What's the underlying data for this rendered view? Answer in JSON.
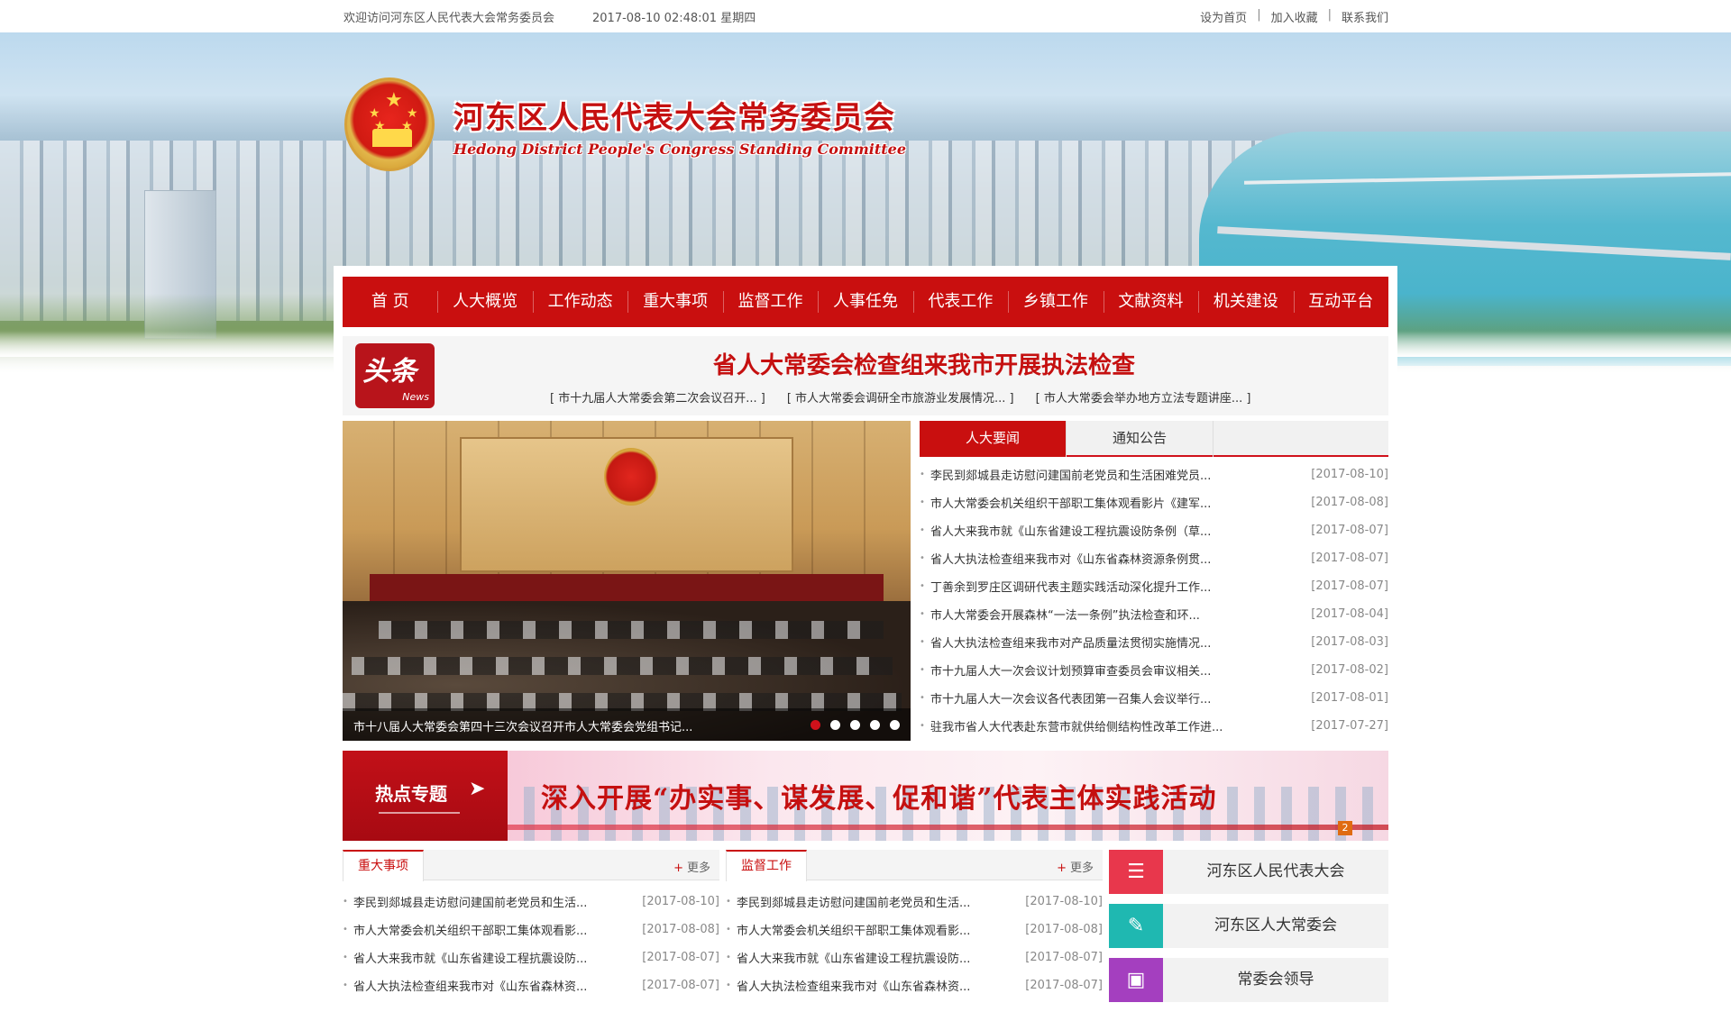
{
  "topbar": {
    "welcome": "欢迎访问河东区人民代表大会常务委员会",
    "datetime": "2017-08-10 02:48:01 星期四",
    "links": [
      "设为首页",
      "加入收藏",
      "联系我们"
    ]
  },
  "header": {
    "title": "河东区人民代表大会常务委员会",
    "subtitle": "Hedong District People's Congress Standing Committee"
  },
  "nav": [
    "首 页",
    "人大概览",
    "工作动态",
    "重大事项",
    "监督工作",
    "人事任免",
    "代表工作",
    "乡镇工作",
    "文献资料",
    "机关建设",
    "互动平台"
  ],
  "headline": {
    "badge": "头条",
    "badge_en": "News",
    "main": "省人大常委会检查组来我市开展执法检查",
    "subs": [
      "[ 市十九届人大常委会第二次会议召开... ]",
      "[ 市人大常委会调研全市旅游业发展情况... ]",
      "[ 市人大常委会举办地方立法专题讲座... ]"
    ]
  },
  "slider": {
    "caption": "市十八届人大常委会第四十三次会议召开市人大常委会党组书记...",
    "dots": 5,
    "active": 0
  },
  "news": {
    "tabs": [
      "人大要闻",
      "通知公告"
    ],
    "active_tab": 0,
    "items": [
      {
        "title": "李民到郯城县走访慰问建国前老党员和生活困难党员...",
        "date": "[2017-08-10]"
      },
      {
        "title": "市人大常委会机关组织干部职工集体观看影片《建军...",
        "date": "[2017-08-08]"
      },
      {
        "title": "省人大来我市就《山东省建设工程抗震设防条例（草...",
        "date": "[2017-08-07]"
      },
      {
        "title": "省人大执法检查组来我市对《山东省森林资源条例贯...",
        "date": "[2017-08-07]"
      },
      {
        "title": "丁善余到罗庄区调研代表主题实践活动深化提升工作...",
        "date": "[2017-08-07]"
      },
      {
        "title": "市人大常委会开展森林“一法一条例”执法检查和环...",
        "date": "[2017-08-04]"
      },
      {
        "title": "省人大执法检查组来我市对产品质量法贯彻实施情况...",
        "date": "[2017-08-03]"
      },
      {
        "title": "市十九届人大一次会议计划预算审查委员会审议相关...",
        "date": "[2017-08-02]"
      },
      {
        "title": "市十九届人大一次会议各代表团第一召集人会议举行...",
        "date": "[2017-08-01]"
      },
      {
        "title": "驻我市省人大代表赴东营市就供给侧结构性改革工作进...",
        "date": "[2017-07-27]"
      }
    ]
  },
  "hot": {
    "label": "热点专题",
    "slogan": "深入开展“办实事、谋发展、促和谐”代表主体实践活动",
    "page": "2"
  },
  "col1": {
    "title": "重大事项",
    "more": "更多",
    "items": [
      {
        "title": "李民到郯城县走访慰问建国前老党员和生活...",
        "date": "[2017-08-10]"
      },
      {
        "title": "市人大常委会机关组织干部职工集体观看影...",
        "date": "[2017-08-08]"
      },
      {
        "title": "省人大来我市就《山东省建设工程抗震设防...",
        "date": "[2017-08-07]"
      },
      {
        "title": "省人大执法检查组来我市对《山东省森林资...",
        "date": "[2017-08-07]"
      }
    ]
  },
  "col2": {
    "title": "监督工作",
    "more": "更多",
    "items": [
      {
        "title": "李民到郯城县走访慰问建国前老党员和生活...",
        "date": "[2017-08-10]"
      },
      {
        "title": "市人大常委会机关组织干部职工集体观看影...",
        "date": "[2017-08-08]"
      },
      {
        "title": "省人大来我市就《山东省建设工程抗震设防...",
        "date": "[2017-08-07]"
      },
      {
        "title": "省人大执法检查组来我市对《山东省森林资...",
        "date": "[2017-08-07]"
      }
    ]
  },
  "side": [
    {
      "label": "河东区人民代表大会",
      "icon": "document-list-icon",
      "color": "#e8374c"
    },
    {
      "label": "河东区人大常委会",
      "icon": "document-pen-icon",
      "color": "#1fb8b1"
    },
    {
      "label": "常委会领导",
      "icon": "id-card-icon",
      "color": "#a43fbf"
    }
  ]
}
